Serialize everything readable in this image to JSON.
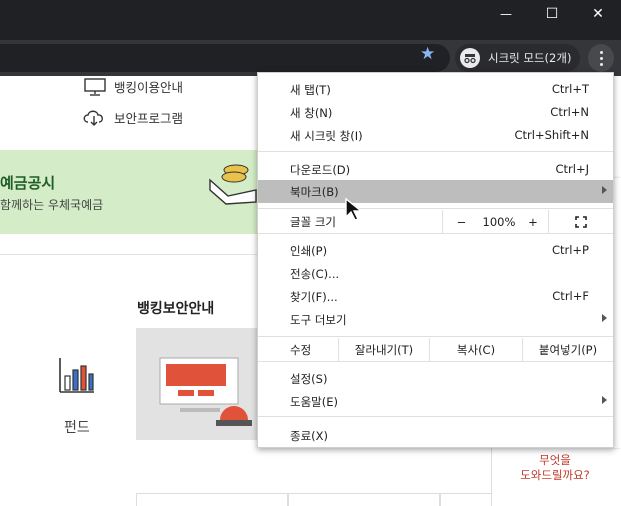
{
  "window": {
    "minimize_glyph": "—",
    "maximize_glyph": "☐",
    "close_glyph": "✕"
  },
  "toolbar": {
    "incognito_label": "시크릿 모드(2개)",
    "star_icon": "star-icon",
    "accent": "#8ab4f8"
  },
  "page": {
    "nav": [
      {
        "label": "뱅킹이용안내",
        "icon": "monitor-icon"
      },
      {
        "label": "보안프로그램",
        "icon": "cloud-download-icon"
      }
    ],
    "banner": {
      "title": "예금공시",
      "subtitle": "함께하는 우체국예금"
    },
    "section_title": "뱅킹보안안내",
    "fund_label": "펀드",
    "help_text_line1": "무엇을",
    "help_text_line2": "도와드릴까요?"
  },
  "menu": {
    "items": [
      {
        "label": "새 탭(T)",
        "shortcut": "Ctrl+T"
      },
      {
        "label": "새 창(N)",
        "shortcut": "Ctrl+N"
      },
      {
        "label": "새 시크릿 창(I)",
        "shortcut": "Ctrl+Shift+N"
      },
      {
        "label": "다운로드(D)",
        "shortcut": "Ctrl+J"
      },
      {
        "label": "북마크(B)",
        "shortcut": ""
      },
      {
        "label": "인쇄(P)",
        "shortcut": "Ctrl+P"
      },
      {
        "label": "전송(C)...",
        "shortcut": ""
      },
      {
        "label": "찾기(F)...",
        "shortcut": "Ctrl+F"
      },
      {
        "label": "도구 더보기",
        "shortcut": ""
      },
      {
        "label": "설정(S)",
        "shortcut": ""
      },
      {
        "label": "도움말(E)",
        "shortcut": ""
      },
      {
        "label": "종료(X)",
        "shortcut": ""
      }
    ],
    "zoom": {
      "label": "글꼴 크기",
      "minus": "−",
      "value": "100%",
      "plus": "+",
      "fullscreen_icon": "fullscreen-icon"
    },
    "edit": {
      "label": "수정",
      "cut": "잘라내기(T)",
      "copy": "복사(C)",
      "paste": "붙여넣기(P)"
    },
    "highlight_color": "#bdbdbd"
  }
}
